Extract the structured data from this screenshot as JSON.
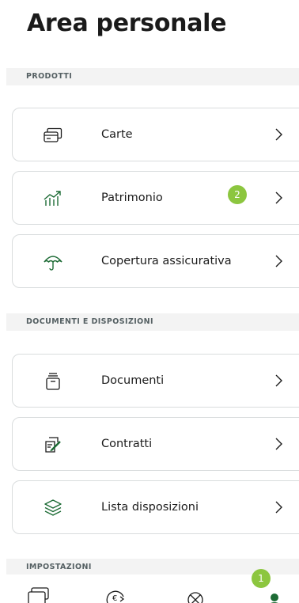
{
  "page": {
    "title": "Area personale"
  },
  "colors": {
    "accent_green": "#2e7d32",
    "badge_green": "#8cc63f",
    "section_bg": "#f3f3f3",
    "border": "#d9dcdd"
  },
  "sections": {
    "prodotti": {
      "header": "PRODOTTI",
      "items": [
        {
          "label": "Carte",
          "icon": "cards-icon"
        },
        {
          "label": "Patrimonio",
          "icon": "growth-chart-icon",
          "badge": "2"
        },
        {
          "label": "Copertura assicurativa",
          "icon": "umbrella-icon"
        }
      ]
    },
    "documenti": {
      "header": "DOCUMENTI E DISPOSIZIONI",
      "items": [
        {
          "label": "Documenti",
          "icon": "document-archive-icon"
        },
        {
          "label": "Contratti",
          "icon": "contract-sign-icon"
        },
        {
          "label": "Lista disposizioni",
          "icon": "layers-icon"
        }
      ]
    },
    "impostazioni": {
      "header": "IMPOSTAZIONI"
    }
  },
  "bottom_nav": {
    "badge": "1",
    "items": [
      {
        "icon": "cards-nav-icon",
        "active": false
      },
      {
        "icon": "euro-transfer-icon",
        "active": false
      },
      {
        "icon": "tools-icon",
        "active": false
      },
      {
        "icon": "profile-icon",
        "active": true
      }
    ]
  }
}
